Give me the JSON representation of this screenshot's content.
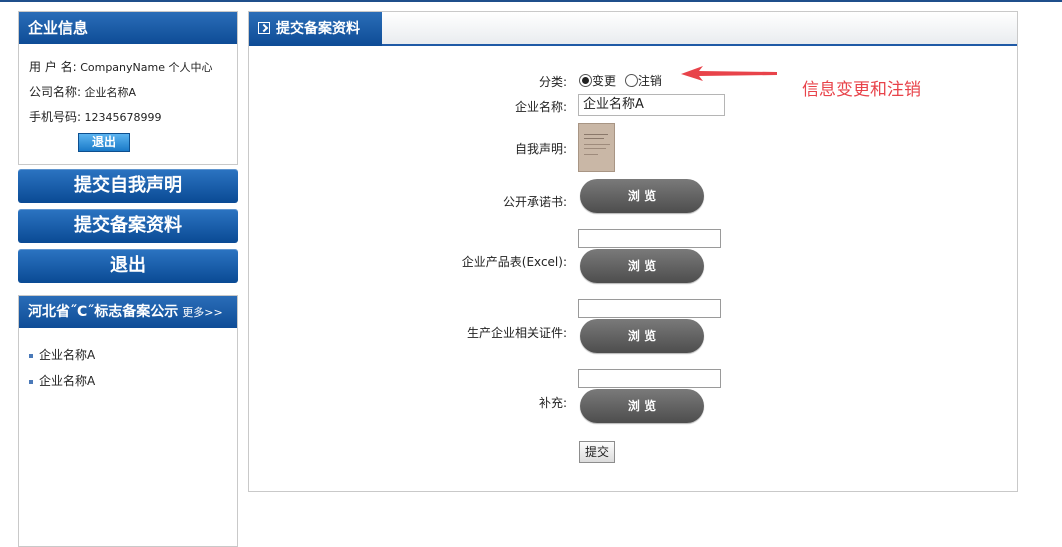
{
  "sidebar": {
    "info_title": "企业信息",
    "username_label": "用 户 名:",
    "username_value": "CompanyName 个人中心",
    "company_label": "公司名称:",
    "company_value": "企业名称A",
    "phone_label": "手机号码:",
    "phone_value": "12345678999",
    "logout_small": "退出",
    "nav": [
      "提交自我声明",
      "提交备案资料",
      "退出"
    ],
    "list_title": "河北省˝C˝标志备案公示",
    "list_more": "更多>>",
    "list_items": [
      "企业名称A",
      "企业名称A"
    ]
  },
  "main": {
    "tab_title": "提交备案资料",
    "category_label": "分类:",
    "option_change": "变更",
    "option_cancel": "注销",
    "selected_option": "变更",
    "company_name_label": "企业名称:",
    "company_name_value": "企业名称A",
    "declaration_label": "自我声明:",
    "commitment_label": "公开承诺书:",
    "product_table_label": "企业产品表(Excel):",
    "certificates_label": "生产企业相关证件:",
    "supplement_label": "补充:",
    "browse_label": "浏 览",
    "submit_label": "提交"
  },
  "annotation": {
    "text": "信息变更和注销",
    "color": "#e8434a"
  },
  "colors": {
    "header_blue": "#0e4c96",
    "browse_gray": "#5a5a5a"
  }
}
